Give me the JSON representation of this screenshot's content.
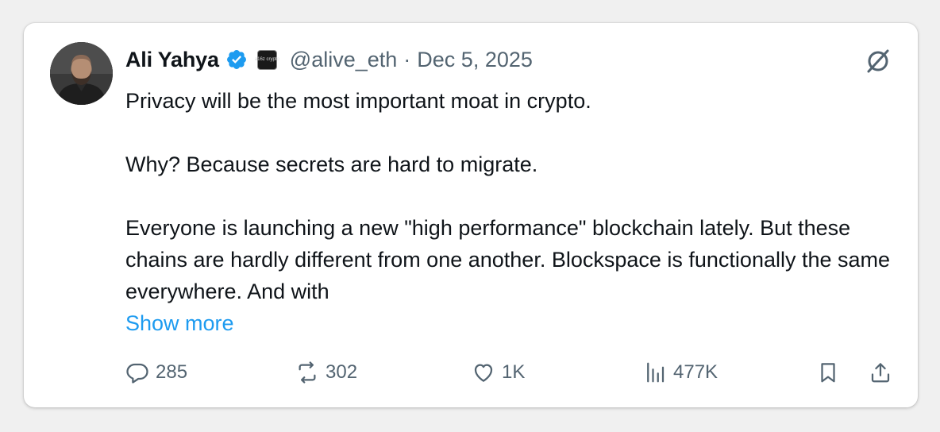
{
  "tweet": {
    "author_name": "Ali Yahya",
    "affiliate_badge_text": "a16z crypto",
    "handle": "@alive_eth",
    "separator": "·",
    "date": "Dec 5, 2025",
    "paragraphs": [
      "Privacy will be the most important moat in crypto.",
      "Why? Because secrets are hard to migrate.",
      "Everyone is launching a new \"high performance\" blockchain lately. But these chains are hardly different from one another. Blockspace is functionally the same everywhere. And with"
    ],
    "show_more": "Show more"
  },
  "actions": {
    "replies": "285",
    "reposts": "302",
    "likes": "1K",
    "views": "477K"
  },
  "icons": {
    "verified": "verified-badge-icon",
    "logo": "x-logo-icon",
    "reply": "reply-icon",
    "repost": "repost-icon",
    "like": "heart-icon",
    "views": "views-chart-icon",
    "bookmark": "bookmark-icon",
    "share": "share-icon"
  },
  "colors": {
    "text": "#0f1419",
    "secondary": "#536471",
    "link": "#1d9bf0",
    "verified": "#1d9bf0"
  }
}
